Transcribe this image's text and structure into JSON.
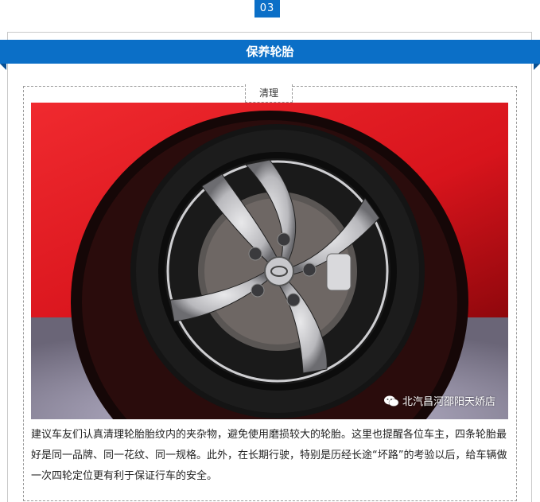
{
  "section": {
    "number": "03",
    "title": "保养轮胎"
  },
  "subsection": {
    "label": "清理"
  },
  "photo": {
    "watermark_text": "北汽昌河邵阳天娇店",
    "watermark_icon": "wechat-icon"
  },
  "body": {
    "paragraph": "建议车友们认真清理轮胎胎纹内的夹杂物，避免使用磨损较大的轮胎。这里也提醒各位车主，四条轮胎最好是同一品牌、同一花纹、同一规格。此外，在长期行驶，特别是历经长途“坏路”的考验以后，给车辆做一次四轮定位更有利于保证行车的安全。"
  },
  "colors": {
    "accent_blue": "#0b6fc7",
    "car_red": "#d8141c"
  }
}
